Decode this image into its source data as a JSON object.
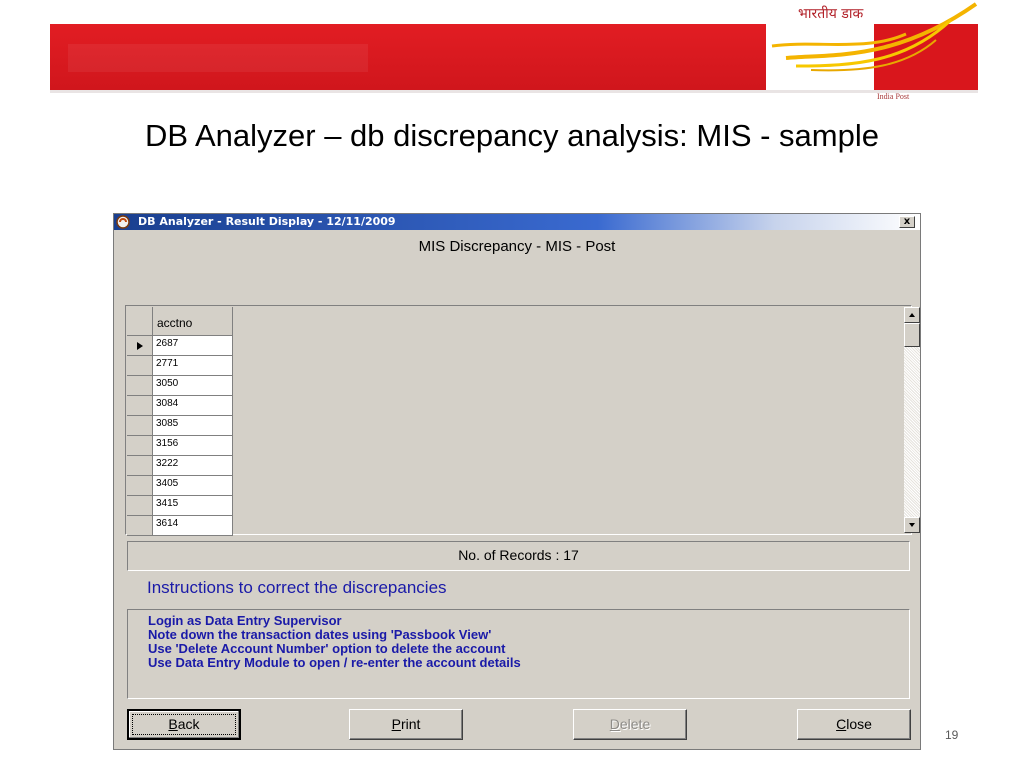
{
  "slide": {
    "logo_hindi": "भारतीय डाक",
    "logo_english": "India Post",
    "title": "DB Analyzer – db discrepancy analysis: MIS - sample",
    "page_number": "19"
  },
  "window": {
    "title": "DB Analyzer - Result Display - 12/11/2009",
    "close_label": "x",
    "report_title": "MIS Discrepancy - MIS - Post"
  },
  "grid": {
    "column_header": "acctno",
    "current_row_index": 0,
    "rows": [
      "2687",
      "2771",
      "3050",
      "3084",
      "3085",
      "3156",
      "3222",
      "3405",
      "3415",
      "3614"
    ]
  },
  "records": {
    "text": "No. of Records : 17"
  },
  "instructions": {
    "heading": "Instructions to correct the discrepancies",
    "lines": [
      "Login as Data Entry Supervisor",
      "Note down the transaction dates using 'Passbook View'",
      "Use 'Delete Account Number' option to delete the account",
      "Use Data Entry Module to open / re-enter the account details"
    ]
  },
  "buttons": {
    "back": {
      "mnemonic": "B",
      "rest": "ack"
    },
    "print": {
      "mnemonic": "P",
      "rest": "rint"
    },
    "delete": {
      "mnemonic": "D",
      "rest": "elete"
    },
    "close": {
      "mnemonic": "C",
      "rest": "lose"
    }
  },
  "colors": {
    "banner_red": "#d9161c",
    "instruction_blue": "#1a1aa8",
    "window_face": "#d4d0c8"
  }
}
